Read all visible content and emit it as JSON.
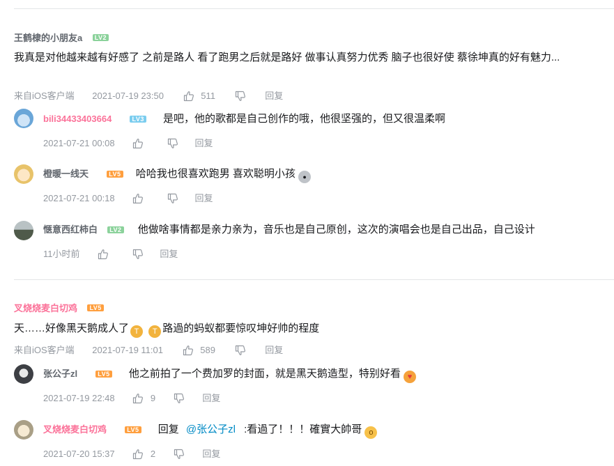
{
  "colors": {
    "lv2": "#8bd29b",
    "lv3": "#7bcdef",
    "lv5": "#ff9f3e",
    "pink": "#fb7299",
    "link": "#008ac5"
  },
  "comments": [
    {
      "user": "王鹤棣的小朋友a",
      "level": "LV2",
      "content": "我真是对他越来越有好感了 之前是路人 看了跑男之后就是路好 做事认真努力优秀 脑子也很好使 蔡徐坤真的好有魅力...",
      "client": "来自iOS客户端",
      "time": "2021-07-19 23:50",
      "likes": "511",
      "reply_label": "回复",
      "replies": [
        {
          "user": "bili34433403664",
          "level": "LV3",
          "content": "是吧，他的歌都是自己创作的哦，他很坚强的，但又很温柔啊",
          "time": "2021-07-21 00:08",
          "likes": "",
          "reply_label": "回复"
        },
        {
          "user": "橙暖一线天",
          "level": "LV5",
          "content": "哈哈我也很喜欢跑男 喜欢聪明小孩",
          "time": "2021-07-21 00:18",
          "likes": "",
          "reply_label": "回复"
        },
        {
          "user": "惬意西红柿白",
          "level": "LV2",
          "content": "他做啥事情都是亲力亲为，音乐也是自己原创，这次的演唱会也是自己出品，自己设计",
          "time": "11小时前",
          "likes": "",
          "reply_label": "回复"
        }
      ]
    },
    {
      "user": "叉烧烧麦白切鸡",
      "level": "LV5",
      "content_a": "天……好像黑天鹅成人了",
      "content_b": "路過的蚂蚁都要惊叹坤好帅的程度",
      "client": "来自iOS客户端",
      "time": "2021-07-19 11:01",
      "likes": "589",
      "reply_label": "回复",
      "replies": [
        {
          "user": "张公子zl",
          "level": "LV5",
          "content": "他之前拍了一个费加罗的封面，就是黑天鹅造型，特别好看",
          "time": "2021-07-19 22:48",
          "likes": "9",
          "reply_label": "回复"
        },
        {
          "user": "叉烧烧麦白切鸡",
          "level": "LV5",
          "reply_prefix": "回复",
          "mention": "@张公子zl",
          "content": ":看過了！！！確實大帥哥",
          "time": "2021-07-20 15:37",
          "likes": "2",
          "reply_label": "回复"
        }
      ]
    }
  ]
}
